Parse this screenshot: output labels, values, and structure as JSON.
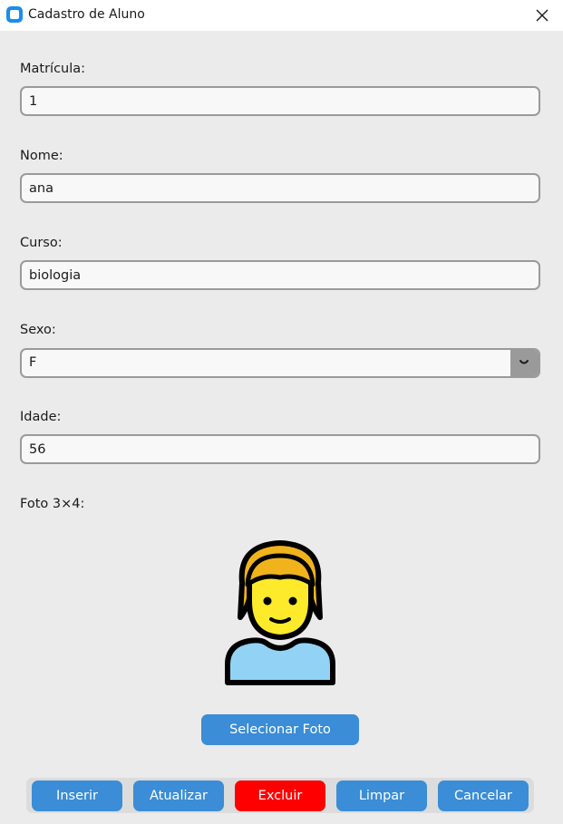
{
  "window": {
    "title": "Cadastro de Aluno",
    "accent": "#1a8cf0"
  },
  "form": {
    "matricula": {
      "label": "Matrícula:",
      "value": "1"
    },
    "nome": {
      "label": "Nome:",
      "value": "ana"
    },
    "curso": {
      "label": "Curso:",
      "value": "biologia"
    },
    "sexo": {
      "label": "Sexo:",
      "value": "F"
    },
    "idade": {
      "label": "Idade:",
      "value": "56"
    },
    "foto": {
      "label": "Foto 3×4:",
      "icon": "person-icon"
    }
  },
  "buttons": {
    "select_photo": "Selecionar Foto",
    "insert": "Inserir",
    "update": "Atualizar",
    "delete": "Excluir",
    "clear": "Limpar",
    "cancel": "Cancelar"
  },
  "colors": {
    "button": "#3a8dd6",
    "danger": "#ff0000",
    "background": "#ebebeb"
  }
}
